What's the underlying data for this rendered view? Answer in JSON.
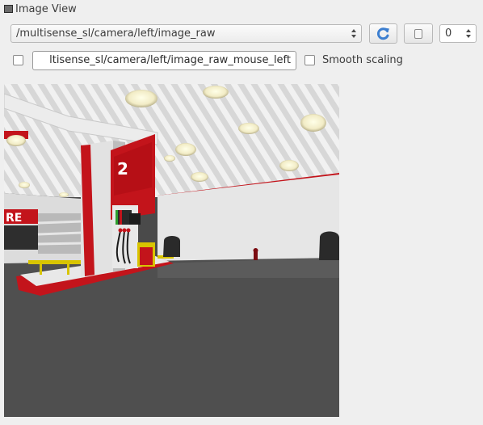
{
  "window": {
    "title": "Image View"
  },
  "toolbar": {
    "topic": "/multisense_sl/camera/left/image_raw",
    "rotation_value": "0"
  },
  "options": {
    "mouse_topic": "ltisense_sl/camera/left/image_raw_mouse_left",
    "mouse_enabled": false,
    "smooth_scaling_label": "Smooth scaling",
    "smooth_scaling_enabled": false
  },
  "image": {
    "sign_number": "2",
    "sign_partial_text": "RE"
  },
  "colors": {
    "window_bg": "#efefef",
    "station_red": "#c3141b",
    "floor": "#4f4f4f",
    "refresh_icon": "#3d7fd0"
  },
  "icons": {
    "window": "window-icon",
    "refresh": "refresh-icon",
    "pause": "pause-icon"
  }
}
